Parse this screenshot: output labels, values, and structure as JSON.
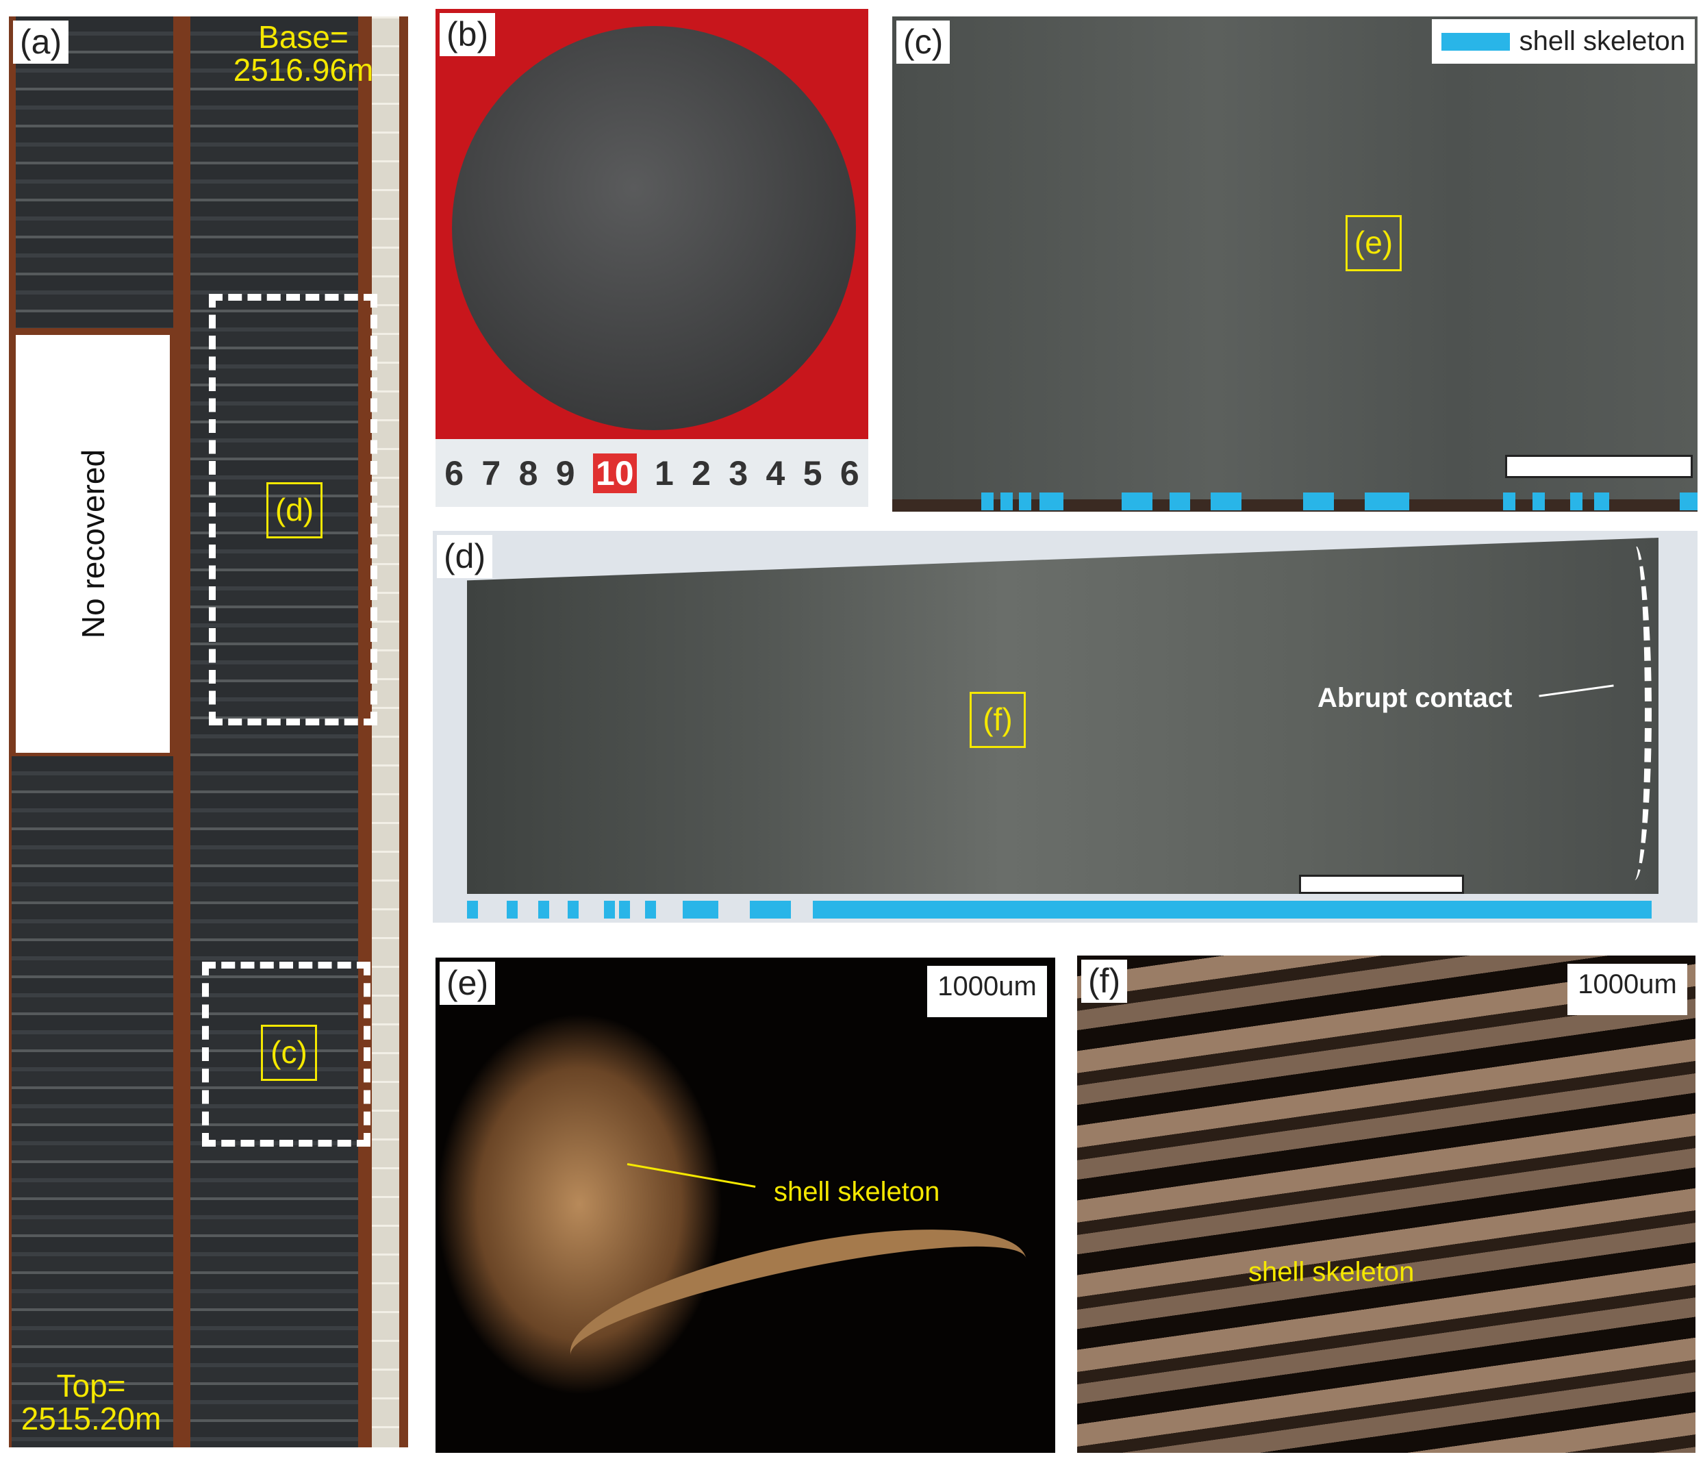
{
  "panels": {
    "a": {
      "label": "(a)",
      "base_label": "Base=",
      "base_depth": "2516.96m",
      "top_label": "Top=",
      "top_depth": "2515.20m",
      "no_recovered": "No recovered",
      "box_d": "(d)",
      "box_c": "(c)"
    },
    "b": {
      "label": "(b)",
      "ruler": [
        "6",
        "7",
        "8",
        "9",
        "10",
        "1",
        "2",
        "3",
        "4",
        "5",
        "6"
      ]
    },
    "c": {
      "label": "(c)",
      "legend": "shell skeleton",
      "box_e": "(e)"
    },
    "d": {
      "label": "(d)",
      "box_f": "(f)",
      "annotation": "Abrupt contact"
    },
    "e": {
      "label": "(e)",
      "scale": "1000um",
      "annotation": "shell skeleton"
    },
    "f": {
      "label": "(f)",
      "scale": "1000um",
      "annotation": "shell skeleton"
    }
  },
  "colors": {
    "highlight": "#f5e800",
    "legend_blue": "#29b5e8",
    "tray": "#7a3a1e",
    "red_bg": "#c8161c"
  }
}
